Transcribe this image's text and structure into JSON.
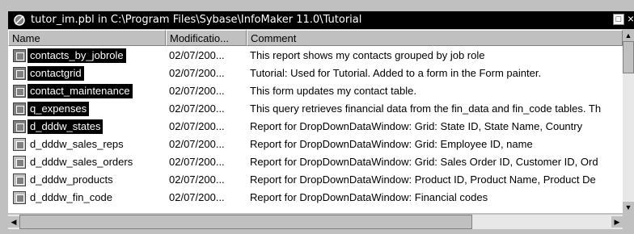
{
  "window": {
    "title": "tutor_im.pbl in C:\\Program Files\\Sybase\\InfoMaker 11.0\\Tutorial",
    "max_button": "□",
    "close_button": "×"
  },
  "columns": {
    "name": "Name",
    "modified": "Modificatio...",
    "comment": "Comment"
  },
  "rows": [
    {
      "name": "contacts_by_jobrole",
      "date": "02/07/200...",
      "comment": "This report shows my contacts grouped by job role",
      "selected": true
    },
    {
      "name": "contactgrid",
      "date": "02/07/200...",
      "comment": "Tutorial: Used for Tutorial. Added to a form in the Form painter.",
      "selected": true
    },
    {
      "name": "contact_maintenance",
      "date": "02/07/200...",
      "comment": "This form updates my contact table.",
      "selected": true
    },
    {
      "name": "q_expenses",
      "date": "02/07/200...",
      "comment": "This query retrieves financial data from the fin_data and fin_code tables. Th",
      "selected": true
    },
    {
      "name": "d_dddw_states",
      "date": "02/07/200...",
      "comment": "Report for DropDownDataWindow: Grid:  State ID, State Name, Country",
      "selected": true
    },
    {
      "name": "d_dddw_sales_reps",
      "date": "02/07/200...",
      "comment": "Report for DropDownDataWindow: Grid:  Employee ID, name",
      "selected": false
    },
    {
      "name": "d_dddw_sales_orders",
      "date": "02/07/200...",
      "comment": "Report for DropDownDataWindow: Grid:  Sales Order ID, Customer ID, Ord",
      "selected": false
    },
    {
      "name": "d_dddw_products",
      "date": "02/07/200...",
      "comment": "Report for DropDownDataWindow: Product ID, Product Name, Product De",
      "selected": false
    },
    {
      "name": "d_dddw_fin_code",
      "date": "02/07/200...",
      "comment": "Report for DropDownDataWindow: Financial codes",
      "selected": false
    }
  ],
  "scroll": {
    "up": "▲",
    "down": "▼",
    "left": "◀",
    "right": "▶"
  },
  "colors": {
    "title_bg": "#000000",
    "selection_bg": "#000000",
    "face": "#c0c0c0"
  }
}
